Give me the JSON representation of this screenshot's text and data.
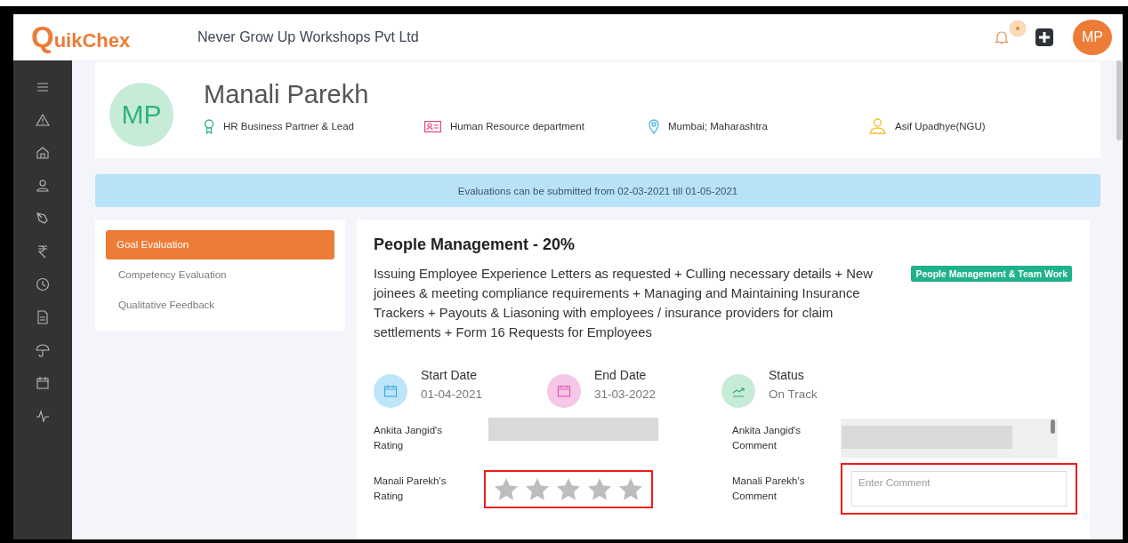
{
  "header": {
    "logo_first": "Q",
    "logo_rest": "uikChex",
    "company": "Never Grow Up Workshops Pvt Ltd",
    "notification_dot": true,
    "avatar": "MP"
  },
  "profile": {
    "initials": "MP",
    "name": "Manali Parekh",
    "details": [
      {
        "kind": "role",
        "text": "HR Business Partner & Lead"
      },
      {
        "kind": "department",
        "text": "Human Resource department"
      },
      {
        "kind": "location",
        "text": "Mumbai; Maharashtra"
      },
      {
        "kind": "manager",
        "text": "Asif Upadhye(NGU)"
      }
    ]
  },
  "banner": "Evaluations can be submitted from 02-03-2021 till 01-05-2021",
  "menu": [
    {
      "label": "Goal Evaluation",
      "selected": true
    },
    {
      "label": "Competency Evaluation",
      "selected": false
    },
    {
      "label": "Qualitative Feedback",
      "selected": false
    }
  ],
  "goal": {
    "title": "People Management - 20%",
    "description": "Issuing Employee Experience Letters as requested + Culling necessary details + New joinees & meeting compliance requirements + Managing and Maintaining Insurance Trackers + Payouts & Liasoning with employees / insurance providers for claim settlements + Form 16 Requests for Employees",
    "tag": "People Management & Team Work",
    "facts": [
      {
        "kind": "date",
        "label": "Start Date",
        "value": "01-04-2021",
        "color": "#bde6fb"
      },
      {
        "kind": "date",
        "label": "End Date",
        "value": "31-03-2022",
        "color": "#f6c6e6"
      },
      {
        "kind": "trend",
        "label": "Status",
        "value": "On Track",
        "color": "#c6ecd8"
      }
    ],
    "ratings": [
      {
        "label": "Ankita Jangid's Rating",
        "kind": "redacted",
        "highlighted": false
      },
      {
        "label": "Manali Parekh's Rating",
        "kind": "stars",
        "stars": 0,
        "highlighted": true
      }
    ],
    "comments": [
      {
        "label": "Ankita Jangid's Comment",
        "kind": "redacted",
        "highlighted": false
      },
      {
        "label": "Manali Parekh's Comment",
        "kind": "input",
        "placeholder": "Enter Comment",
        "highlighted": true
      }
    ]
  }
}
